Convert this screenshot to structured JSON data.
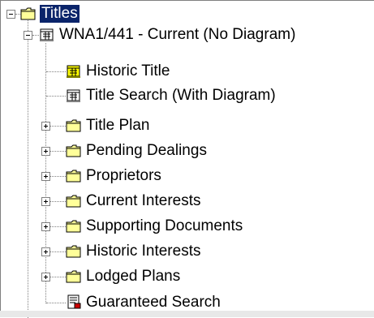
{
  "tree": {
    "root": {
      "label": "Titles",
      "icon": "folder-icon",
      "state": "expanded",
      "selected": true
    },
    "title": {
      "label": "WNA1/441 - Current (No Diagram)",
      "icon": "title-document-icon",
      "state": "expanded"
    },
    "children": [
      {
        "label": "Historic Title",
        "icon": "historic-title-icon",
        "expander": false
      },
      {
        "label": "Title Search (With Diagram)",
        "icon": "title-search-icon",
        "expander": false
      },
      {
        "label": "Title Plan",
        "icon": "folder-icon",
        "expander": true
      },
      {
        "label": "Pending Dealings",
        "icon": "folder-icon",
        "expander": true
      },
      {
        "label": "Proprietors",
        "icon": "folder-icon",
        "expander": true
      },
      {
        "label": "Current Interests",
        "icon": "folder-icon",
        "expander": true
      },
      {
        "label": "Supporting Documents",
        "icon": "folder-icon",
        "expander": true
      },
      {
        "label": "Historic Interests",
        "icon": "folder-icon",
        "expander": true
      },
      {
        "label": "Lodged Plans",
        "icon": "folder-icon",
        "expander": true
      },
      {
        "label": "Guaranteed Search",
        "icon": "guaranteed-search-icon",
        "expander": false
      }
    ]
  },
  "colors": {
    "selection": "#0a246a",
    "folder": "#ffff99",
    "tree_lines": "#808080"
  }
}
